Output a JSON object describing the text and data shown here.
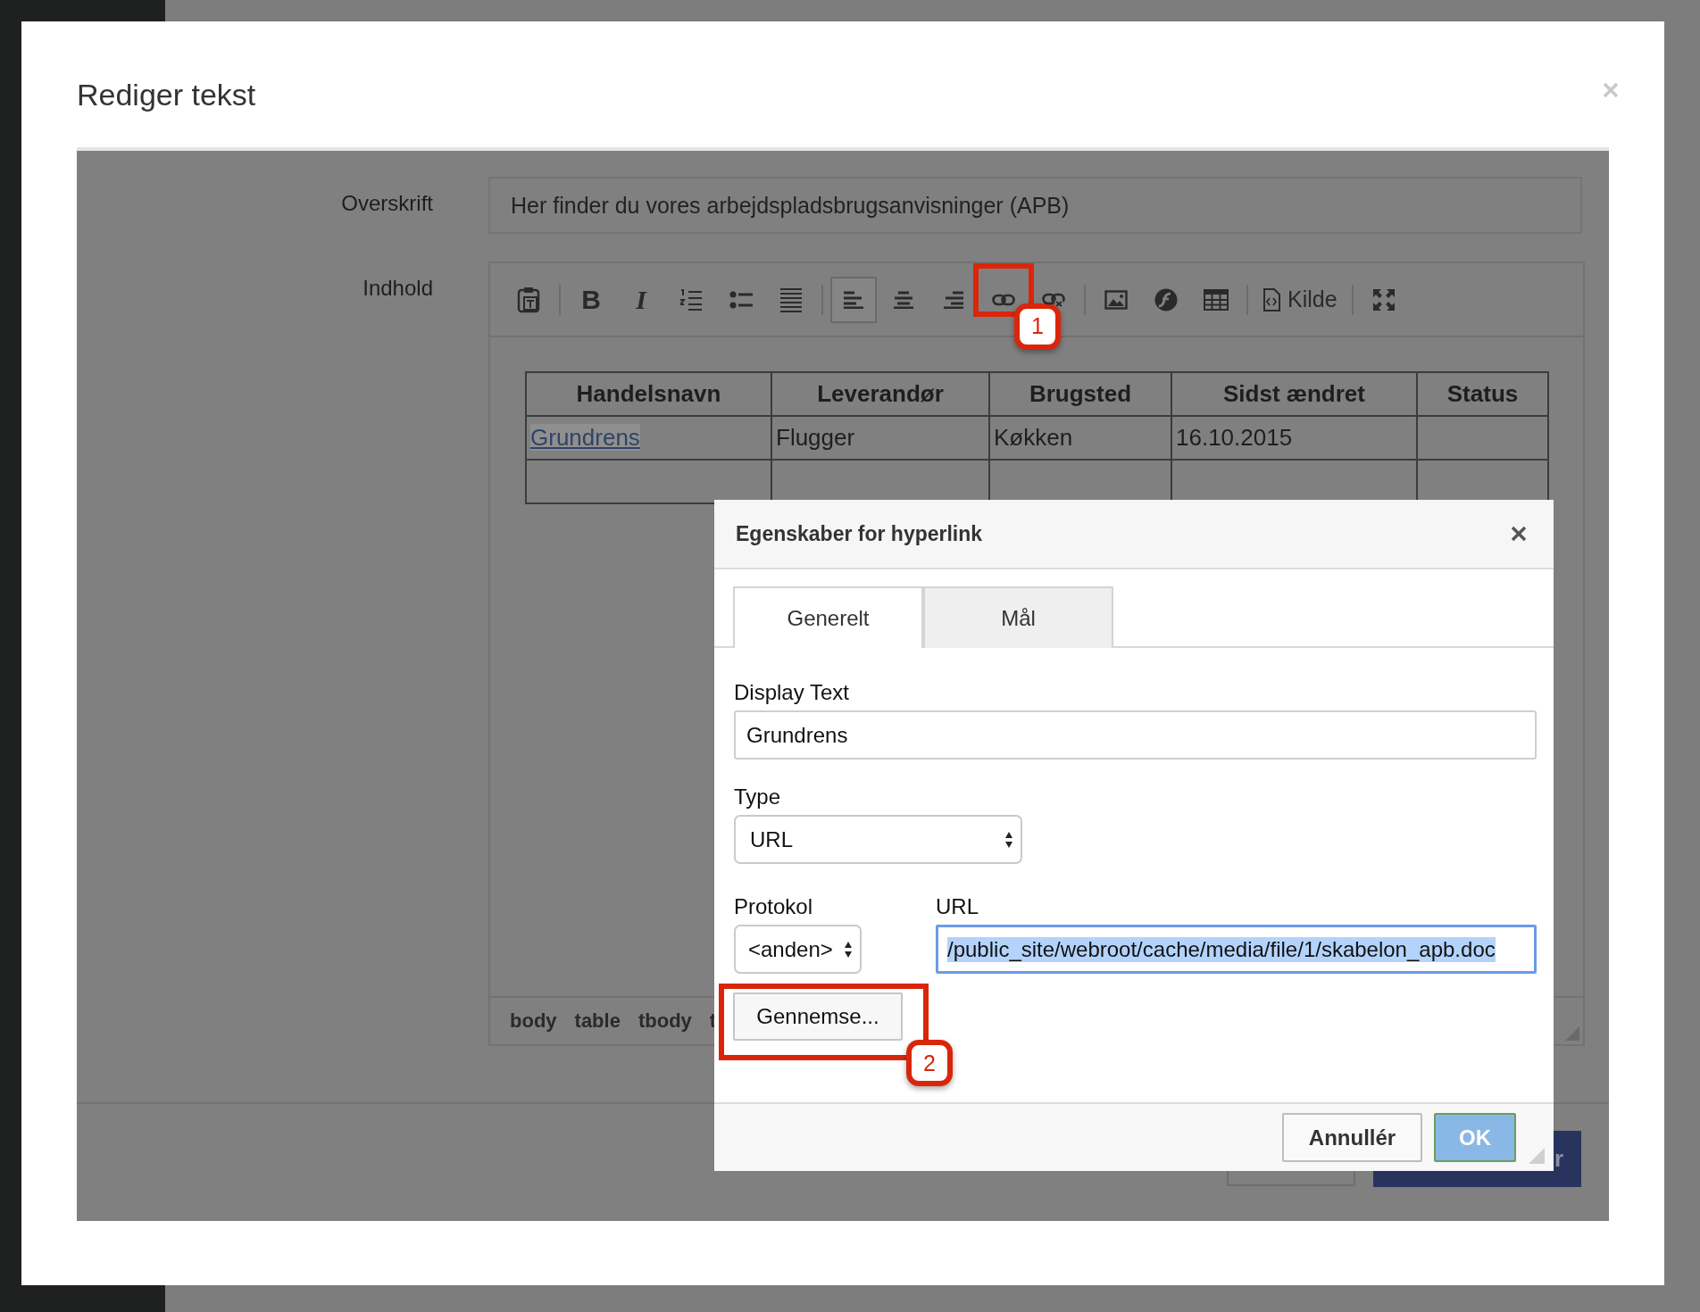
{
  "modal": {
    "title": "Rediger tekst"
  },
  "form": {
    "heading_label": "Overskrift",
    "heading_value": "Her finder du vores arbejdspladsbrugsanvisninger (APB)",
    "content_label": "Indhold"
  },
  "toolbar": [
    {
      "kind": "paste",
      "selected": false
    },
    {
      "kind": "separator"
    },
    {
      "kind": "bold",
      "glyph": "B",
      "selected": false
    },
    {
      "kind": "italic",
      "glyph": "I",
      "selected": false
    },
    {
      "kind": "ordered-list",
      "selected": false
    },
    {
      "kind": "bullet-list",
      "selected": false
    },
    {
      "kind": "justify",
      "selected": false
    },
    {
      "kind": "separator"
    },
    {
      "kind": "align-left",
      "selected": true
    },
    {
      "kind": "align-center",
      "selected": false
    },
    {
      "kind": "align-right",
      "selected": false
    },
    {
      "kind": "link",
      "selected": false,
      "callout": "1"
    },
    {
      "kind": "unlink",
      "selected": false
    },
    {
      "kind": "separator"
    },
    {
      "kind": "image",
      "selected": false
    },
    {
      "kind": "flash",
      "selected": false
    },
    {
      "kind": "table",
      "selected": false
    },
    {
      "kind": "separator"
    },
    {
      "kind": "source",
      "label": "Kilde",
      "selected": false
    },
    {
      "kind": "separator"
    },
    {
      "kind": "maximize",
      "selected": false
    }
  ],
  "table": {
    "columns": [
      "Handelsnavn",
      "Leverandør",
      "Brugsted",
      "Sidst ændret",
      "Status"
    ],
    "rows": [
      [
        {
          "text": "Grundrens",
          "kind": "link",
          "selected": true
        },
        {
          "text": "Flugger",
          "kind": "text"
        },
        {
          "text": "Køkken",
          "kind": "text"
        },
        {
          "text": "16.10.2015",
          "kind": "text"
        }
      ]
    ]
  },
  "path_bar": [
    "body",
    "table",
    "tbody",
    "t"
  ],
  "modal_footer": {
    "save_button": "r"
  },
  "dialog": {
    "title": "Egenskaber for hyperlink",
    "tabs": [
      {
        "label": "Generelt",
        "selected": true
      },
      {
        "label": "Mål",
        "selected": false
      }
    ],
    "display_text": {
      "label": "Display Text",
      "value": "Grundrens"
    },
    "type": {
      "label": "Type",
      "value": "URL"
    },
    "protocol": {
      "label": "Protokol",
      "value": "<anden>"
    },
    "url": {
      "label": "URL",
      "value": "/public_site/webroot/cache/media/file/1/skabelon_apb.doc",
      "focused": true,
      "text_selected": true
    },
    "browse_button": {
      "label": "Gennemse...",
      "callout": "2"
    },
    "cancel_button": "Annullér",
    "ok_button": "OK"
  }
}
